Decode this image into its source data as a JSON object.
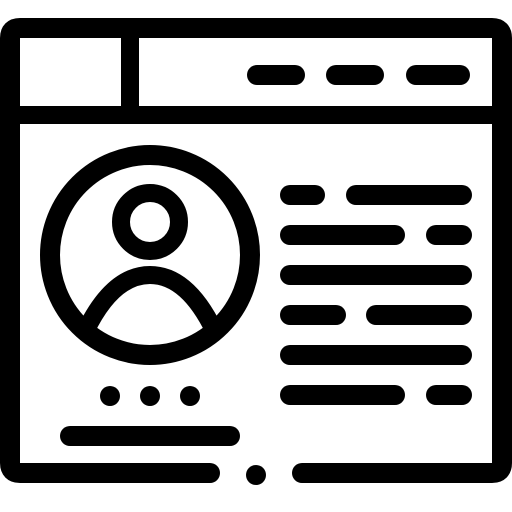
{
  "icon": {
    "name": "profile-page-icon",
    "description_visible": "",
    "stroke_color": "#000000",
    "background_color": "#ffffff",
    "style": "outline"
  },
  "window": {
    "title_bar": {
      "tab_block": "tab",
      "menu_dashes": 3
    },
    "profile": {
      "avatar": "user-avatar-icon",
      "pagination_dots": 3
    },
    "text_lines": 6
  }
}
